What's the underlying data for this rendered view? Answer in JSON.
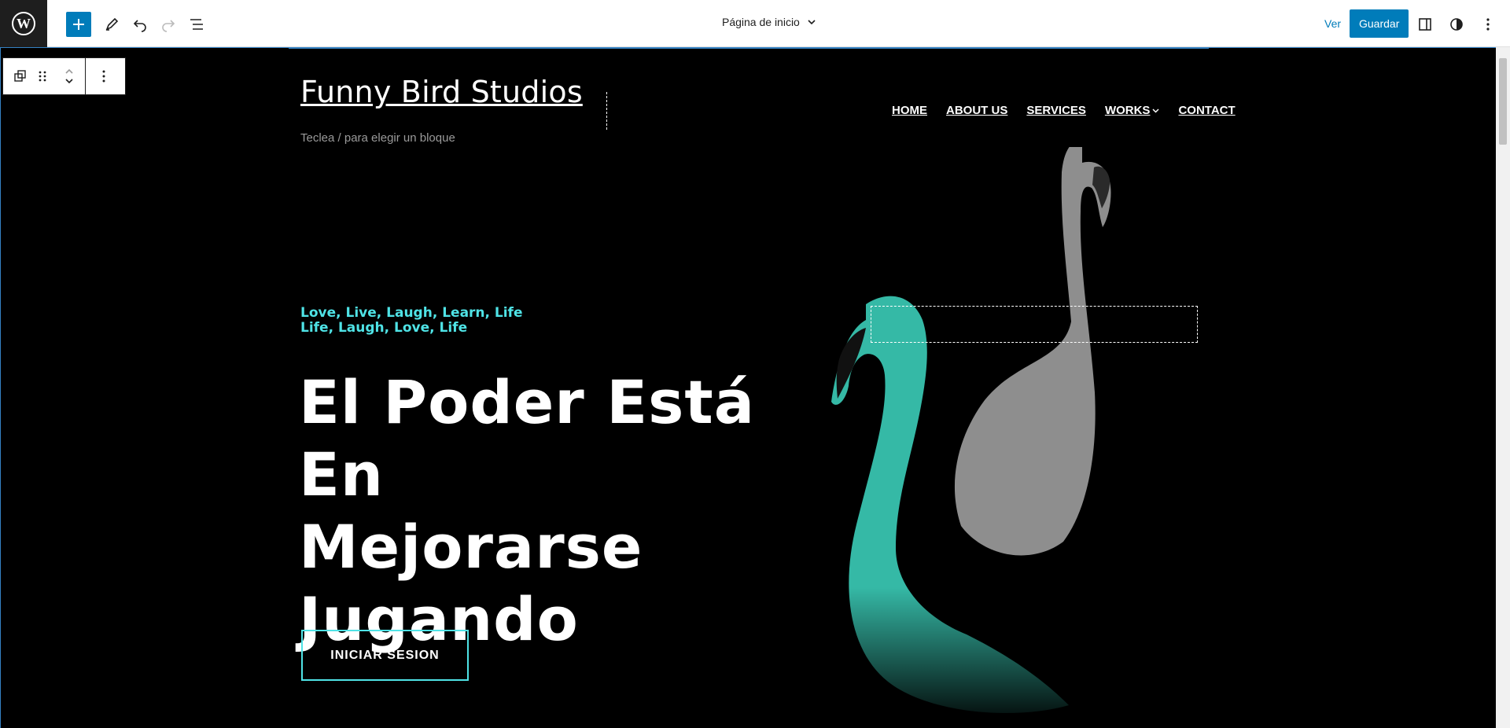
{
  "topbar": {
    "document_title": "Página de inicio",
    "view_label": "Ver",
    "save_label": "Guardar"
  },
  "site": {
    "title": "Funny Bird Studios",
    "tagline_placeholder": "Teclea / para elegir un bloque"
  },
  "nav": {
    "items": [
      "HOME",
      "ABOUT US",
      "SERVICES",
      "WORKS",
      "CONTACT"
    ]
  },
  "hero": {
    "subtitle_line1": "Love, Live, Laugh, Learn, Life",
    "subtitle_line2": "Life, Laugh, Love, Life",
    "headline_line1": "El Poder Está En",
    "headline_line2": "Mejorarse",
    "headline_line3": "Jugando",
    "cta_label": "INICIAR SESION"
  },
  "colors": {
    "accent": "#4fe3e6",
    "wp_blue": "#007cba",
    "canvas_bg": "#000000"
  }
}
